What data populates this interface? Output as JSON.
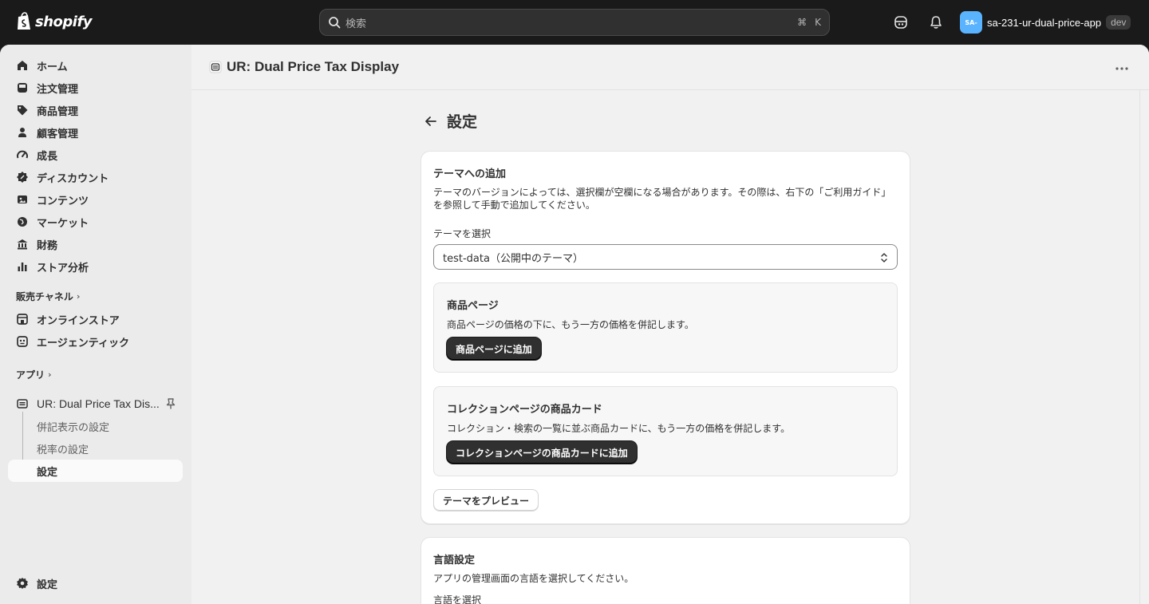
{
  "topbar": {
    "logo_text": "shopify",
    "search_placeholder": "検索",
    "shortcut_cmd": "⌘",
    "shortcut_key": "K",
    "avatar_initials": "SA-",
    "account_name": "sa-231-ur-dual-price-app",
    "env_badge": "dev",
    "colors": {
      "bar": "#1a1a1a",
      "avatar": "#5ab3ff"
    }
  },
  "sidebar": {
    "items": [
      {
        "label": "ホーム",
        "icon": "home-icon"
      },
      {
        "label": "注文管理",
        "icon": "inbox-icon"
      },
      {
        "label": "商品管理",
        "icon": "tag-icon"
      },
      {
        "label": "顧客管理",
        "icon": "person-icon"
      },
      {
        "label": "成長",
        "icon": "gauge-icon"
      },
      {
        "label": "ディスカウント",
        "icon": "discount-icon"
      },
      {
        "label": "コンテンツ",
        "icon": "content-icon"
      },
      {
        "label": "マーケット",
        "icon": "globe-icon"
      },
      {
        "label": "財務",
        "icon": "bank-icon"
      },
      {
        "label": "ストア分析",
        "icon": "chart-bar-icon"
      }
    ],
    "sales_channels_label": "販売チャネル",
    "channels": [
      {
        "label": "オンラインストア",
        "icon": "store-icon"
      },
      {
        "label": "エージェンティック",
        "icon": "agent-icon"
      }
    ],
    "apps_label": "アプリ",
    "app_name": "UR: Dual Price Tax Dis...",
    "app_sub_items": [
      "併記表示の設定",
      "税率の設定",
      "設定"
    ],
    "settings_label": "設定"
  },
  "header": {
    "app_title": "UR: Dual Price Tax Display"
  },
  "page": {
    "title": "設定",
    "theme_card": {
      "title": "テーマへの追加",
      "description_line1": "テーマのバージョンによっては、選択欄が空欄になる場合があります。その際は、右下の「ご利用ガイド」",
      "description_line2": "を参照して手動で追加してください。",
      "select_label": "テーマを選択",
      "select_value": "test-data（公開中のテーマ）",
      "product_page": {
        "title": "商品ページ",
        "text": "商品ページの価格の下に、もう一方の価格を併記します。",
        "button": "商品ページに追加"
      },
      "collection_page": {
        "title": "コレクションページの商品カード",
        "text": "コレクション・検索の一覧に並ぶ商品カードに、もう一方の価格を併記します。",
        "button": "コレクションページの商品カードに追加"
      },
      "preview_button": "テーマをプレビュー"
    },
    "language_card": {
      "title": "言語設定",
      "description": "アプリの管理画面の言語を選択してください。",
      "select_label": "言語を選択"
    }
  }
}
